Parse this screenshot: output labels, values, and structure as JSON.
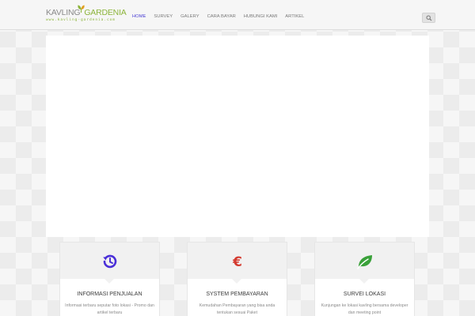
{
  "logo": {
    "word1": "KAVLING",
    "word2": "GARDENIA",
    "url": "www.kavling-gardenia.com"
  },
  "nav": {
    "items": [
      {
        "label": "HOME"
      },
      {
        "label": "SURVEY"
      },
      {
        "label": "GALERY"
      },
      {
        "label": "CARA BAYAR"
      },
      {
        "label": "HUBUNGI KAMI"
      },
      {
        "label": "ARTIKEL"
      }
    ],
    "active_color": "#4a3fd4"
  },
  "search": {
    "icon": "search-icon"
  },
  "features": [
    {
      "icon": "history-icon",
      "icon_color": "#4a2fd8",
      "title": "INFORMASI PENJUALAN",
      "desc": "Informasi terbaru seputar foto lokasi - Promo dan artikel terbaru"
    },
    {
      "icon": "euro-icon",
      "icon_color": "#d43a2f",
      "title": "SYSTEM PEMBAYARAN",
      "desc": "Kemudahan Pembayaran yang bisa anda tentukan sesuai Paket"
    },
    {
      "icon": "leaf-icon",
      "icon_color": "#3aa13a",
      "title": "SURVEI LOKASI",
      "desc": "Kunjungan ke lokasi kavling bersama developer dan meeting point"
    }
  ]
}
